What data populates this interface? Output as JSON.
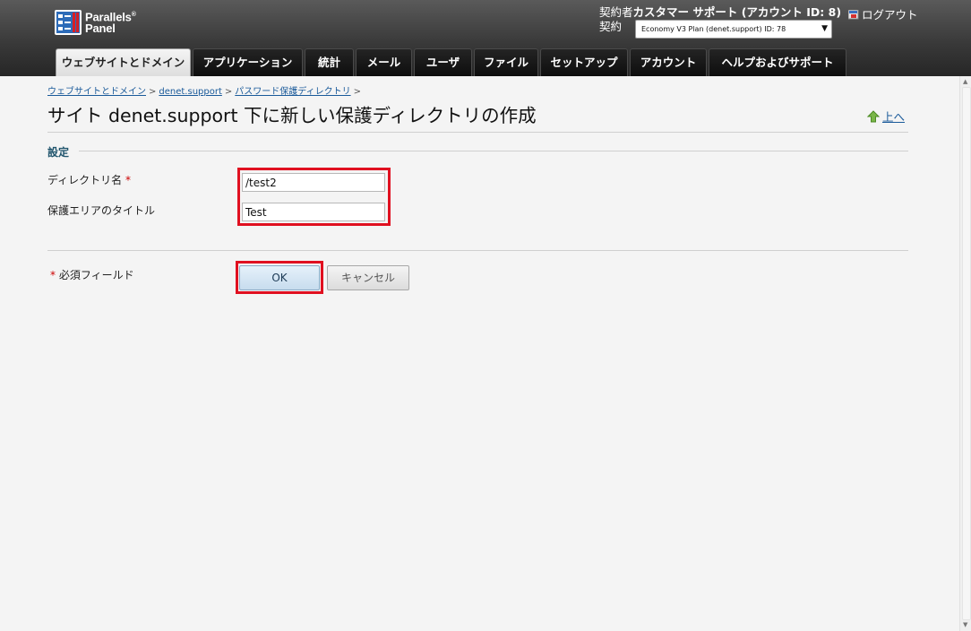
{
  "header": {
    "logo_line1": "Parallels",
    "logo_reg": "®",
    "logo_line2": "Panel",
    "account_label": "契約者",
    "account_value": "カスタマー サポート (アカウント ID: 8)",
    "subscription_label": "契約",
    "subscription_value": "Economy V3 Plan (denet.support) ID: 78",
    "logout_label": "ログアウト"
  },
  "nav": {
    "tabs": [
      {
        "label": "ウェブサイトとドメイン",
        "active": true
      },
      {
        "label": "アプリケーション"
      },
      {
        "label": "統計"
      },
      {
        "label": "メール"
      },
      {
        "label": "ユーザ"
      },
      {
        "label": "ファイル"
      },
      {
        "label": "セットアップ"
      },
      {
        "label": "アカウント"
      },
      {
        "label": "ヘルプおよびサポート"
      }
    ]
  },
  "breadcrumb": {
    "items": [
      "ウェブサイトとドメイン",
      "denet.support",
      "パスワード保護ディレクトリ"
    ],
    "separator": ">"
  },
  "page": {
    "title": "サイト denet.support 下に新しい保護ディレクトリの作成",
    "up_link": "上へ"
  },
  "form": {
    "section_title": "設定",
    "directory_label": "ディレクトリ名",
    "required_mark": "*",
    "directory_value": "/test2",
    "realm_label": "保護エリアのタイトル",
    "realm_value": "Test",
    "required_note": "必須フィールド",
    "ok_label": "OK",
    "cancel_label": "キャンセル"
  },
  "colors": {
    "highlight": "#e01020",
    "link": "#1a5a9a",
    "header_dark": "#262626"
  }
}
